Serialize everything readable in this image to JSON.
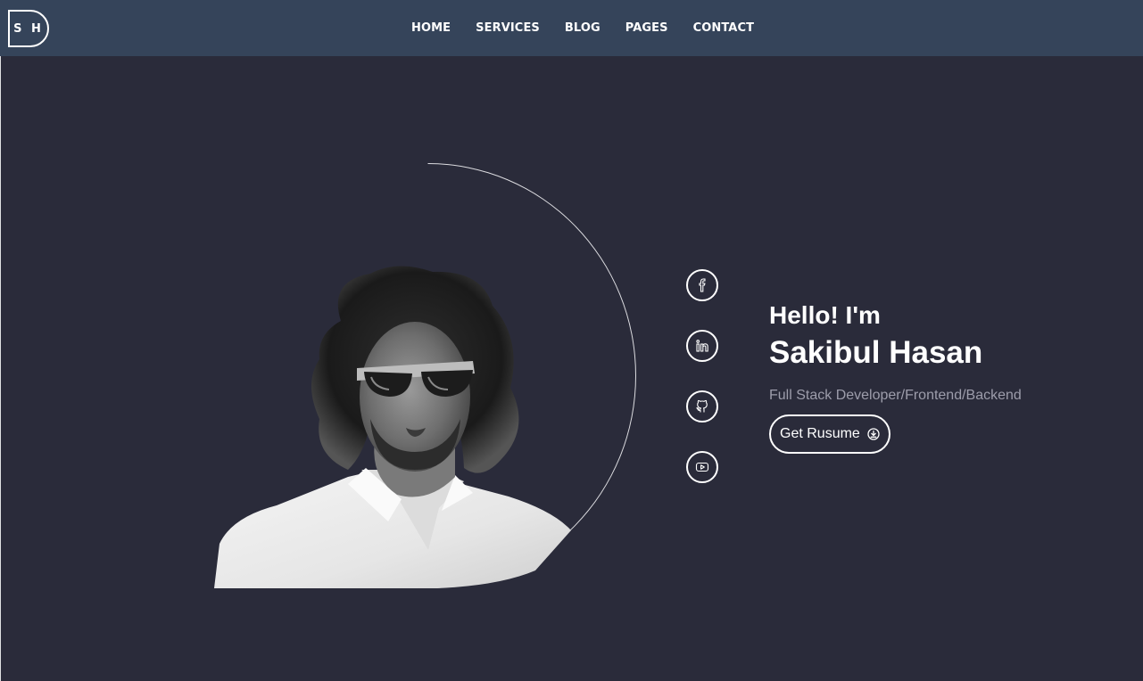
{
  "header": {
    "logo_text": "S H",
    "nav": [
      {
        "label": "HOME"
      },
      {
        "label": "SERVICES"
      },
      {
        "label": "BLOG"
      },
      {
        "label": "PAGES"
      },
      {
        "label": "CONTACT"
      }
    ]
  },
  "hero": {
    "greeting": "Hello! I'm",
    "name": "Sakibul Hasan",
    "role": "Full Stack Developer/Frontend/Backend",
    "resume_label": "Get Rusume",
    "resume_icon": "download-icon",
    "portrait": "portrait-photo",
    "social": [
      {
        "icon": "facebook-icon"
      },
      {
        "icon": "linkedin-icon"
      },
      {
        "icon": "github-icon"
      },
      {
        "icon": "youtube-icon"
      }
    ]
  },
  "colors": {
    "background": "#2a2b3a",
    "navbar": "#35445a",
    "text": "#ffffff",
    "muted": "#9d9dab"
  }
}
